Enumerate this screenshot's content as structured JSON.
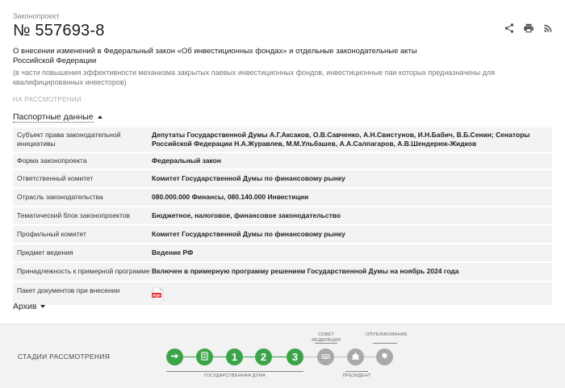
{
  "header": {
    "kicker": "Законопроект",
    "number": "№ 557693-8",
    "actions": [
      {
        "icon": "share-icon"
      },
      {
        "icon": "print-icon"
      },
      {
        "icon": "rss-icon"
      }
    ]
  },
  "bill": {
    "title": "О внесении изменений в Федеральный закон «Об инвестиционных фондах» и отдельные законодательные акты Российской Федерации",
    "subtitle": "(в части повышения эффективности механизма закрытых паевых инвестиционных фондов, инвестиционные паи которых предназначены для квалифицированных инвесторов)",
    "status": "НА РАССМОТРЕНИИ"
  },
  "passport": {
    "toggle_label": "Паспортные данные",
    "rows": [
      {
        "key": "Субъект права законодательной инициативы",
        "value": "Депутаты Государственной Думы А.Г.Аксаков, О.В.Савченко, А.Н.Свистунов, И.Н.Бабич, В.Б.Сенин; Сенаторы Российской Федерации Н.А.Журавлев, М.М.Ульбашев, А.А.Салпагаров, А.В.Шендерюк-Жидков"
      },
      {
        "key": "Форма законопроекта",
        "value": "Федеральный закон"
      },
      {
        "key": "Ответственный комитет",
        "value": "Комитет Государственной Думы по финансовому рынку"
      },
      {
        "key": "Отрасль законодательства",
        "value": "080.000.000 Финансы, 080.140.000 Инвестиции"
      },
      {
        "key": "Тематический блок законопроектов",
        "value": "Бюджетное, налоговое, финансовое законодательство"
      },
      {
        "key": "Профильный комитет",
        "value": "Комитет Государственной Думы по финансовому рынку"
      },
      {
        "key": "Предмет ведения",
        "value": "Ведение РФ"
      },
      {
        "key": "Принадлежность к примерной программе",
        "value": "Включен в примерную программу решением Государственной Думы на ноябрь 2024 года"
      },
      {
        "key": "Пакет документов при внесении",
        "value": ""
      }
    ],
    "pdf_icon": "pdf-file-icon"
  },
  "archive": {
    "toggle_label": "Архив"
  },
  "stages": {
    "label": "СТАДИИ РАССМОТРЕНИЯ",
    "items": [
      {
        "icon": "arrow-right-icon",
        "state": "done"
      },
      {
        "icon": "document-list-icon",
        "state": "done"
      },
      {
        "text": "1",
        "state": "done"
      },
      {
        "text": "2",
        "state": "done"
      },
      {
        "text": "3",
        "state": "done"
      },
      {
        "icon": "federation-council-icon",
        "state": "todo"
      },
      {
        "icon": "president-icon",
        "state": "todo"
      },
      {
        "icon": "eagle-emblem-icon",
        "state": "todo"
      }
    ],
    "captions": {
      "council": "СОВЕТ\nФЕДЕРАЦИИ",
      "publication": "ОПУБЛИКОВАНИЕ",
      "duma": "ГОСУДАРСТВЕННАЯ ДУМА",
      "president": "ПРЕЗИДЕНТ"
    },
    "colors": {
      "done": "#3aa548",
      "todo": "#a9a9a9"
    }
  }
}
